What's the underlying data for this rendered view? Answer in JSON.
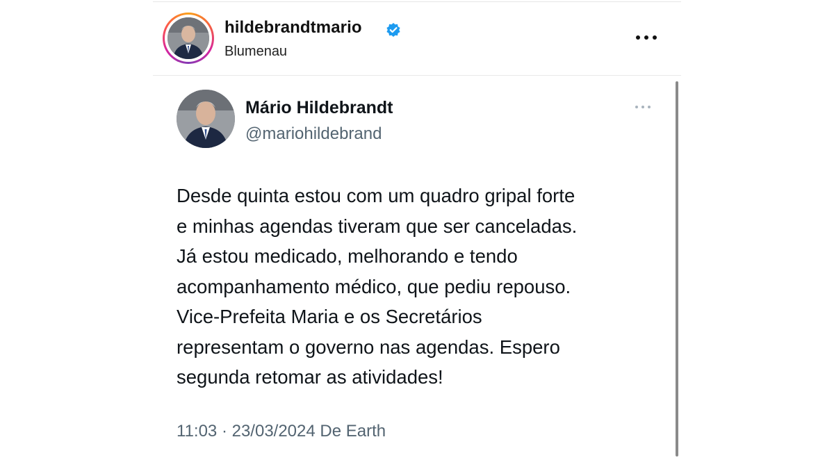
{
  "instagram_header": {
    "username": "hildebrandtmario",
    "location": "Blumenau",
    "verified_icon": "verified-badge-icon",
    "more_icon": "more-horizontal-icon"
  },
  "tweet": {
    "display_name": "Mário Hildebrandt",
    "handle": "@mariohildebrand",
    "more_icon": "more-horizontal-icon",
    "text": "Desde quinta estou com um quadro gripal forte\ne minhas agendas tiveram que ser canceladas.\nJá estou medicado, melhorando e tendo\nacompanhamento médico, que pediu repouso.\nVice-Prefeita Maria e os Secretários\nrepresentam o governo nas agendas. Espero\nsegunda retomar as atividades!",
    "timestamp": "11:03 · 23/03/2024 De Earth"
  },
  "colors": {
    "verified_blue": "#1d9bf0",
    "secondary_text": "#536471",
    "primary_text": "#0f1419"
  }
}
